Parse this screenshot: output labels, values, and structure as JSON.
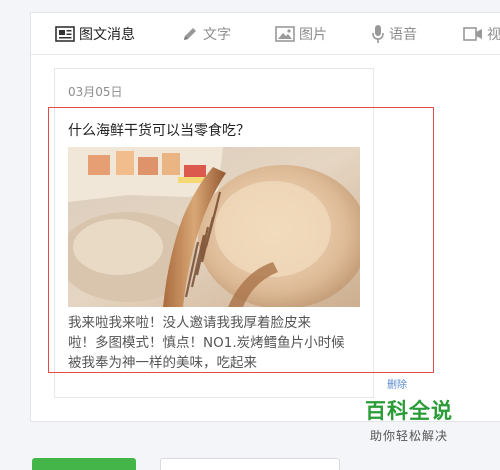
{
  "tabs": [
    {
      "label": "图文消息",
      "icon": "news-icon",
      "active": true
    },
    {
      "label": "文字",
      "icon": "pencil-icon",
      "active": false
    },
    {
      "label": "图片",
      "icon": "image-icon",
      "active": false
    },
    {
      "label": "语音",
      "icon": "microphone-icon",
      "active": false
    },
    {
      "label": "视",
      "icon": "video-icon",
      "active": false
    }
  ],
  "article": {
    "date": "03月05日",
    "title": "什么海鲜干货可以当零食吃？",
    "cover_alt": "烤鳕鱼片与扇贝干",
    "desc_lines": [
      "我来啦我来啦！没人邀请我我厚着脸皮来",
      "啦！多图模式！慎点！NO1.炭烤鳕鱼片小时候",
      "被我奉为神一样的美味，吃起来"
    ]
  },
  "link_partial": "删除",
  "buttons": {
    "primary_label": "",
    "secondary_label": ""
  },
  "watermark": {
    "title": "百科全说",
    "subtitle": "助你轻松解决"
  },
  "colors": {
    "accent_green": "#44b549",
    "highlight_red": "#e44c4c",
    "watermark_green": "#2a9c37",
    "link_blue": "#5a8bd0"
  }
}
